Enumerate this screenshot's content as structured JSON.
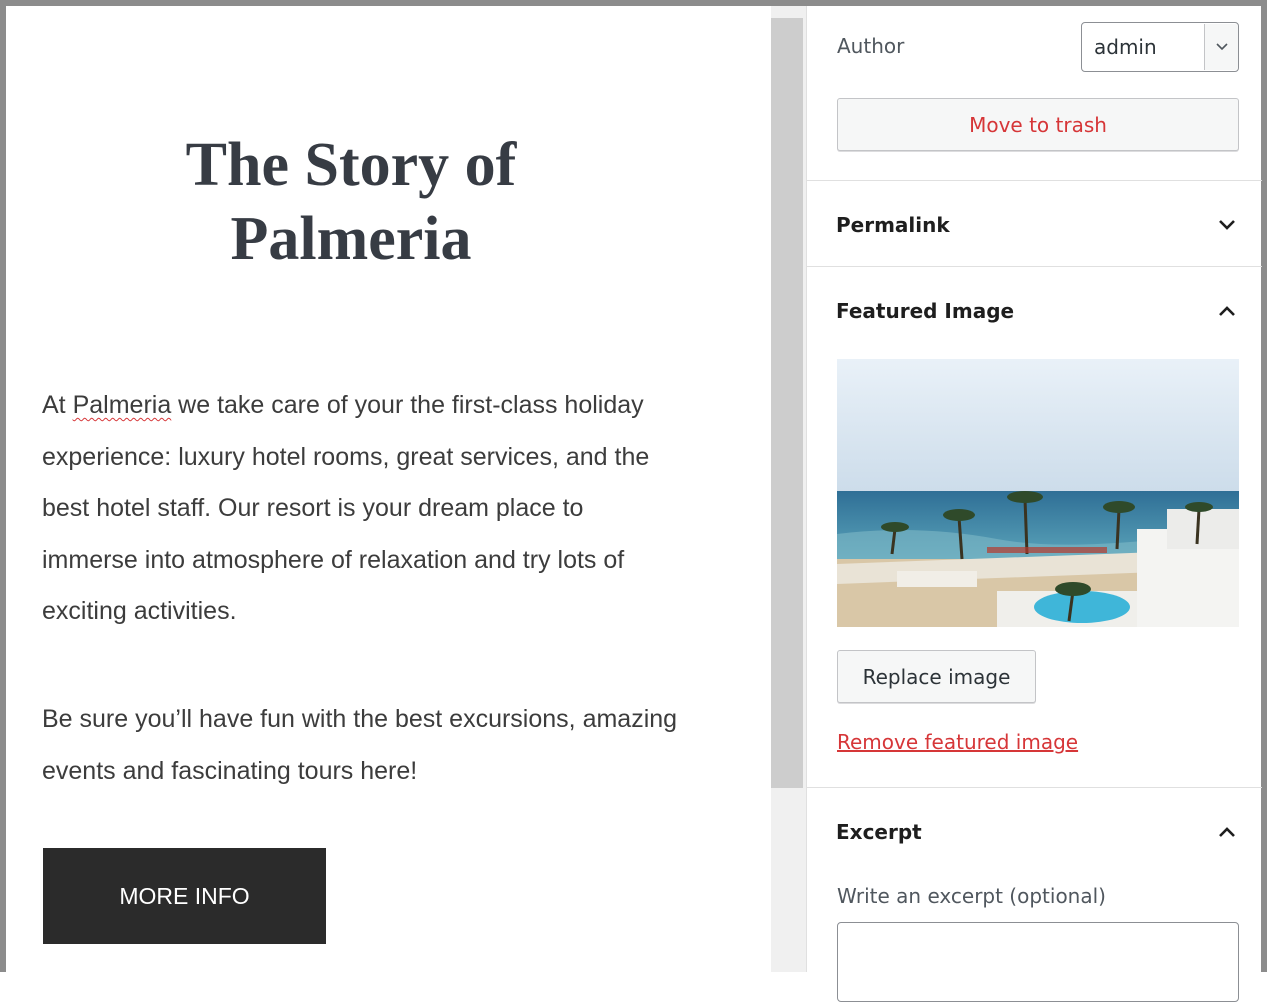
{
  "editor": {
    "title": "The Story of Palmeria",
    "paragraph1_before": "At ",
    "paragraph1_misspelled": "Palmeria",
    "paragraph1_after": " we take care of your the first-class holiday experience: luxury hotel rooms, great services, and the best hotel staff. Our resort is your dream place to immerse into atmosphere of relaxation and try lots of exciting activities.",
    "paragraph2": "Be sure you’ll have fun with the best excursions, amazing events and fascinating tours here!",
    "button_label": "MORE INFO"
  },
  "sidebar": {
    "author_label": "Author",
    "author_value": "admin",
    "trash_label": "Move to trash",
    "permalink": {
      "title": "Permalink",
      "expanded": false,
      "icon": "chevron-down-icon"
    },
    "featured_image": {
      "title": "Featured Image",
      "expanded": true,
      "icon": "chevron-up-icon",
      "replace_label": "Replace image",
      "remove_label": "Remove featured image"
    },
    "excerpt": {
      "title": "Excerpt",
      "expanded": true,
      "icon": "chevron-up-icon",
      "field_label": "Write an excerpt (optional)",
      "value": ""
    }
  },
  "colors": {
    "destructive": "#d63638",
    "button_dark": "#2b2b2b",
    "title_text": "#373c44"
  }
}
